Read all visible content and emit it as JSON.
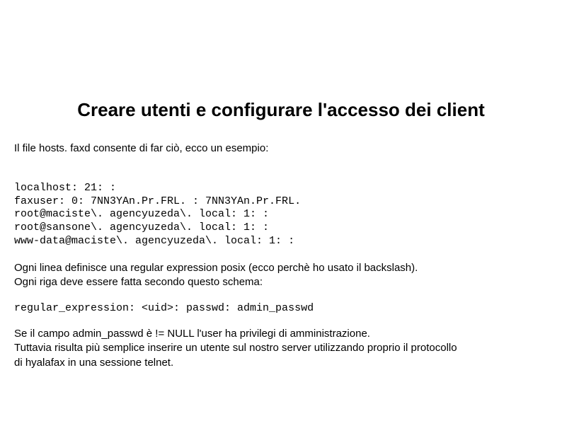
{
  "title": "Creare utenti e configurare l'accesso dei client",
  "intro": "Il file hosts. faxd consente di far ciò, ecco un esempio:",
  "code_lines": [
    "localhost: 21: :",
    "faxuser: 0: 7NN3YAn.Pr.FRL. : 7NN3YAn.Pr.FRL.",
    "root@maciste\\. agencyuzeda\\. local: 1: :",
    "root@sansone\\. agencyuzeda\\. local: 1: :",
    "www-data@maciste\\. agencyuzeda\\. local: 1: :"
  ],
  "para1_l1": "Ogni linea definisce una regular expression posix (ecco perchè ho usato il backslash).",
  "para1_l2": "Ogni riga deve essere fatta secondo questo schema:",
  "schema": "regular_expression: <uid>: passwd: admin_passwd",
  "para2_l1": "Se il campo admin_passwd è != NULL l'user ha privilegi di amministrazione.",
  "para2_l2": "Tuttavia risulta più semplice inserire un utente sul nostro server utilizzando proprio il protocollo",
  "para2_l3": "di hyalafax in una sessione telnet."
}
